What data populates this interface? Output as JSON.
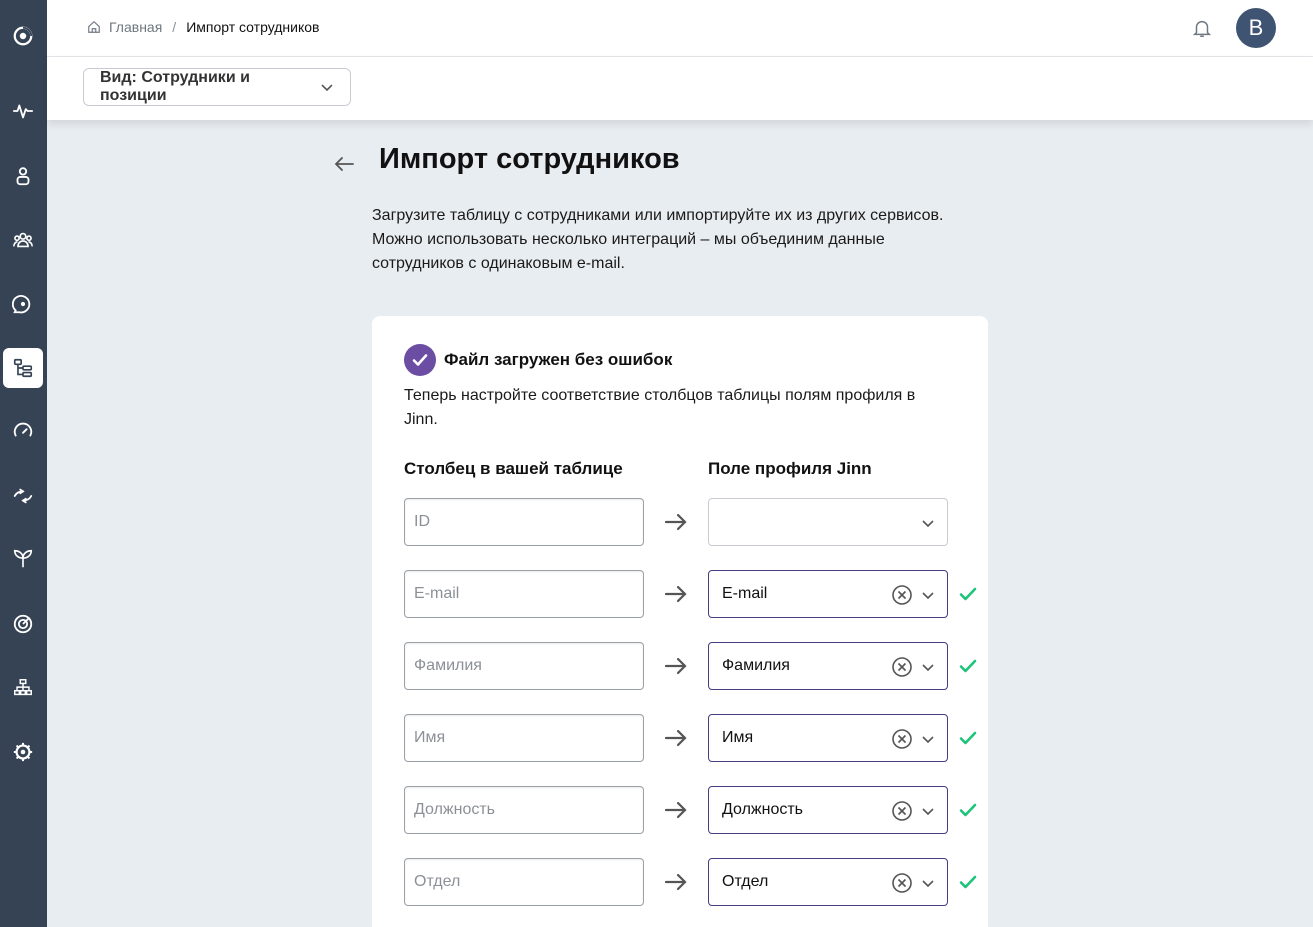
{
  "breadcrumb": {
    "home": "Главная",
    "separator": "/",
    "current": "Импорт сотрудников"
  },
  "user": {
    "avatar_letter": "В"
  },
  "view_select": {
    "label": "Вид: Сотрудники и позиции"
  },
  "page": {
    "title": "Импорт сотрудников",
    "intro_line1": "Загрузите таблицу с сотрудниками или импортируйте их из других сервисов.",
    "intro_line2": "Можно использовать несколько интеграций – мы объединим данные",
    "intro_line3": "сотрудников с одинаковым e-mail."
  },
  "card": {
    "status": "Файл загружен без ошибок",
    "instruction": "Теперь настройте соответствие столбцов таблицы полям профиля в Jinn.",
    "col_source": "Столбец в вашей таблице",
    "col_target": "Поле профиля Jinn",
    "rows": [
      {
        "placeholder": "ID",
        "target": ""
      },
      {
        "placeholder": "E-mail",
        "target": "E-mail"
      },
      {
        "placeholder": "Фамилия",
        "target": "Фамилия"
      },
      {
        "placeholder": "Имя",
        "target": "Имя"
      },
      {
        "placeholder": "Должность",
        "target": "Должность"
      },
      {
        "placeholder": "Отдел",
        "target": "Отдел"
      }
    ]
  },
  "colors": {
    "sidebar": "#364355",
    "accent": "#6b4ea3",
    "select_border": "#4a3a7e",
    "check": "#1ec47c"
  },
  "sidebar_icons": [
    "logo-icon",
    "pulse-icon",
    "person-icon",
    "team-icon",
    "chat-icon",
    "org-structure-icon",
    "gauge-icon",
    "sync-icon",
    "sprout-icon",
    "target-icon",
    "hierarchy-icon",
    "settings-icon"
  ]
}
